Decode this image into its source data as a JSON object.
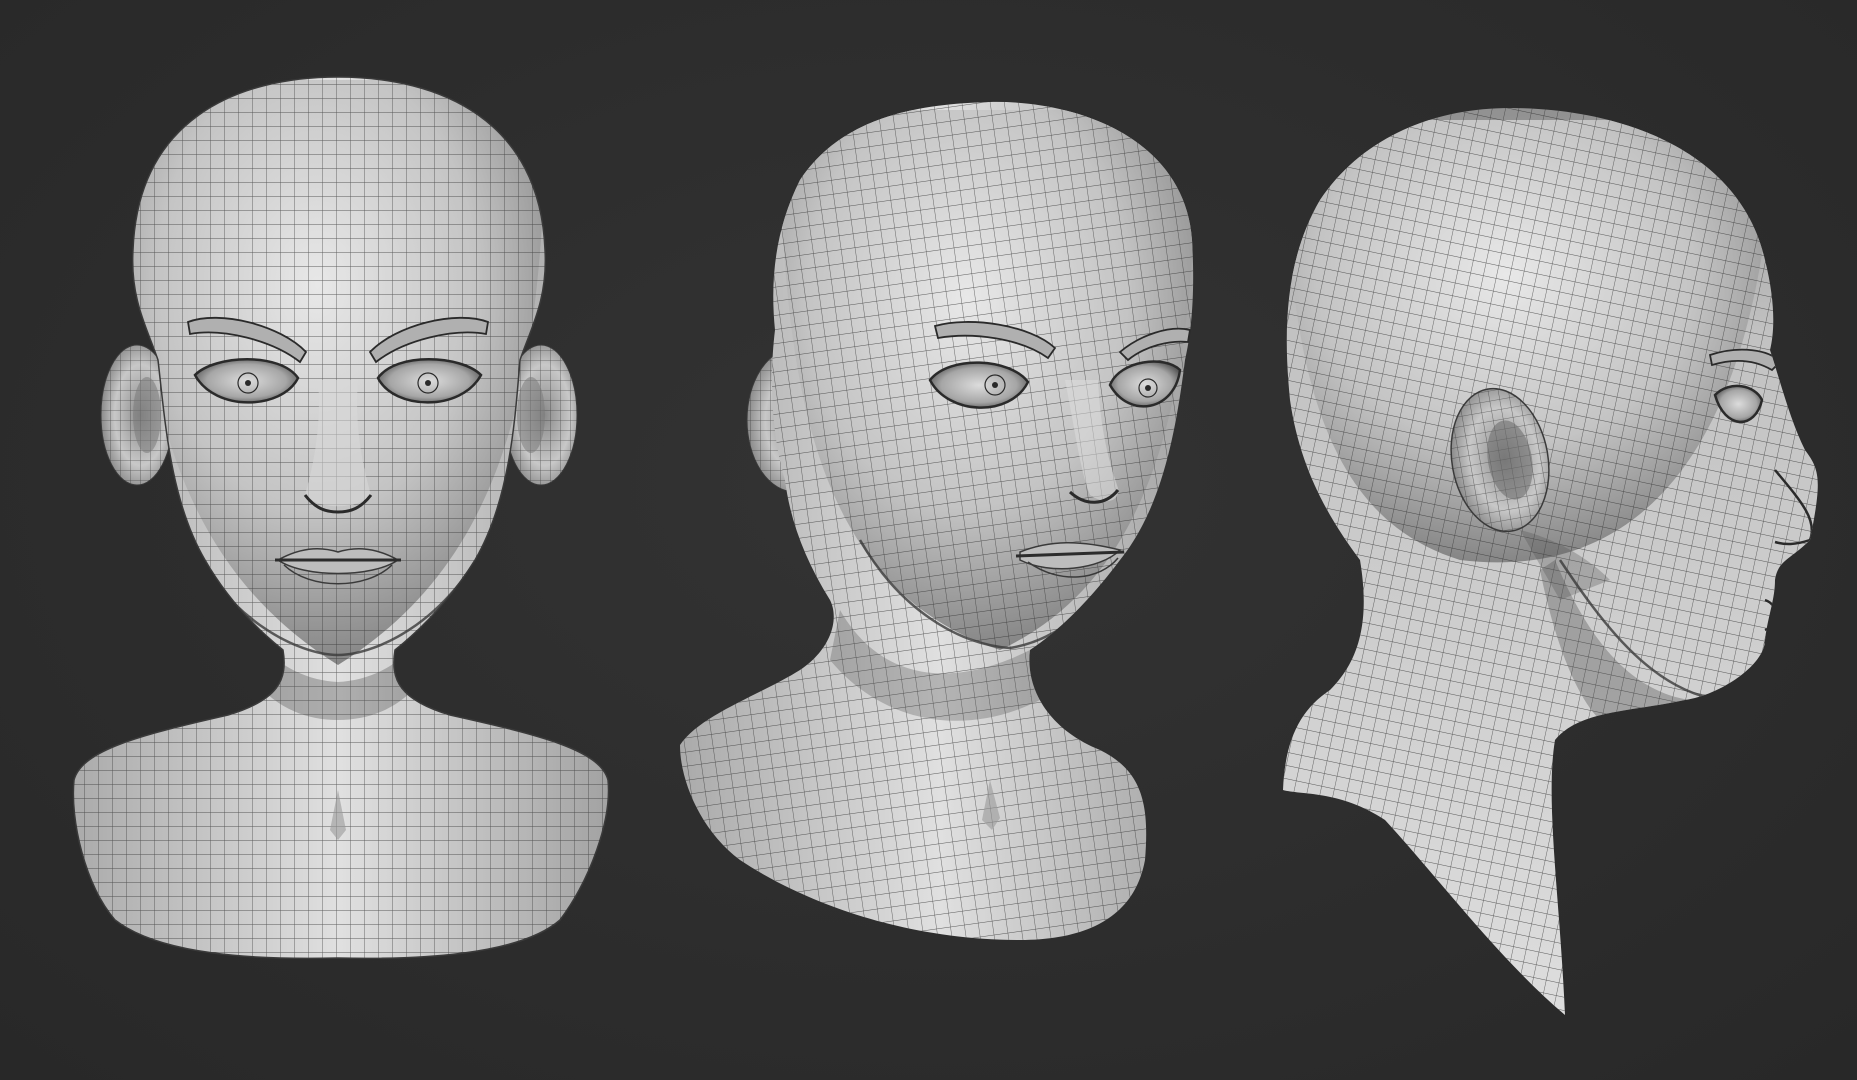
{
  "scene": {
    "background_color": "#2d2d2d",
    "mesh_base_color": "#c9c9c9",
    "mesh_highlight_color": "#e6e6e6",
    "mesh_shadow_color": "#6a6a6a",
    "wire_color": "#2a2a2a"
  },
  "views": [
    {
      "id": "front",
      "icon": "head-front-view"
    },
    {
      "id": "three-quarter",
      "icon": "head-three-quarter-view"
    },
    {
      "id": "side",
      "icon": "head-side-view"
    }
  ]
}
